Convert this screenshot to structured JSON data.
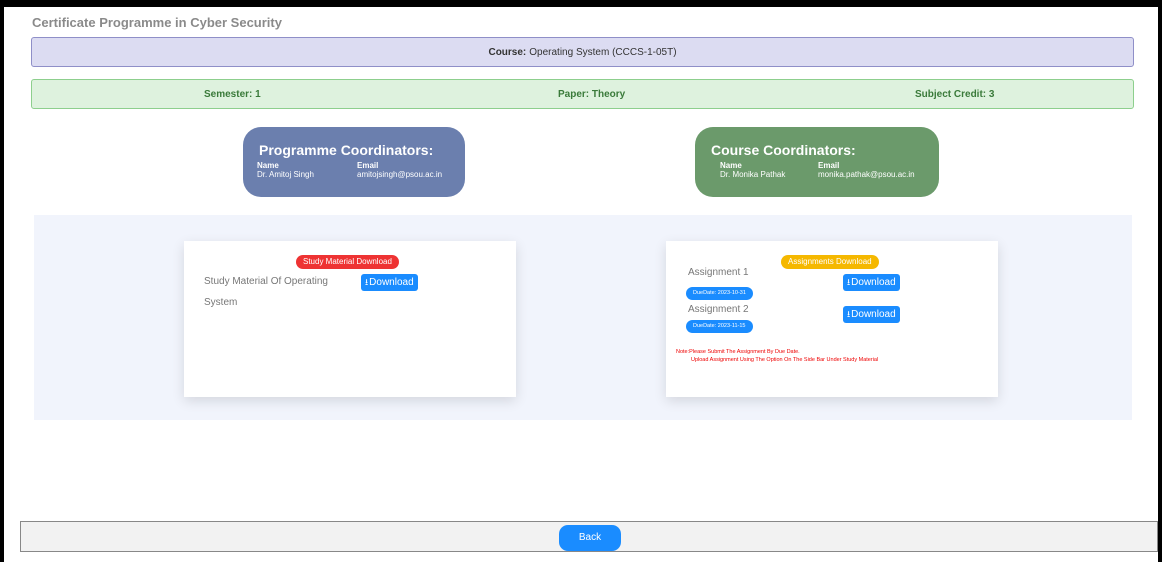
{
  "page": {
    "title": "Certificate Programme in Cyber Security"
  },
  "course": {
    "label": "Course:",
    "value": "Operating System (CCCS-1-05T)"
  },
  "info": {
    "semester": "Semester: 1",
    "paper": "Paper: Theory",
    "credit": "Subject Credit: 3"
  },
  "programme_coordinators": {
    "title": "Programme Coordinators:",
    "name_header": "Name",
    "email_header": "Email",
    "name": "Dr. Amitoj Singh",
    "email": "amitojsingh@psou.ac.in"
  },
  "course_coordinators": {
    "title": "Course Coordinators:",
    "name_header": "Name",
    "email_header": "Email",
    "name": "Dr. Monika Pathak",
    "email": "monika.pathak@psou.ac.in"
  },
  "study": {
    "badge": "Study Material Download",
    "item_label": "Study Material Of Operating System",
    "download_label": "Download",
    "download_icon": "download-icon"
  },
  "assignments": {
    "badge": "Assignments Download",
    "items": [
      {
        "label": "Assignment 1",
        "due": "DueDate: 2023-10-31",
        "download_label": "Download"
      },
      {
        "label": "Assignment 2",
        "due": "DueDate: 2023-11-15",
        "download_label": "Download"
      }
    ],
    "note_line1": "Note:Please Submit The Assignment By Due Date.",
    "note_line2": "Upload Assignment Using The Option On The Side Bar Under Study Material"
  },
  "footer": {
    "back_label": "Back"
  },
  "colors": {
    "accent": "#1a8cff",
    "course_bar_bg": "#dcdcf2",
    "info_bar_bg": "#def2de",
    "programme_card": "#6b7fae",
    "course_card": "#6b9a6b",
    "badge_red": "#ee3333",
    "badge_yellow": "#f5b800",
    "note_red": "#ee0000"
  }
}
